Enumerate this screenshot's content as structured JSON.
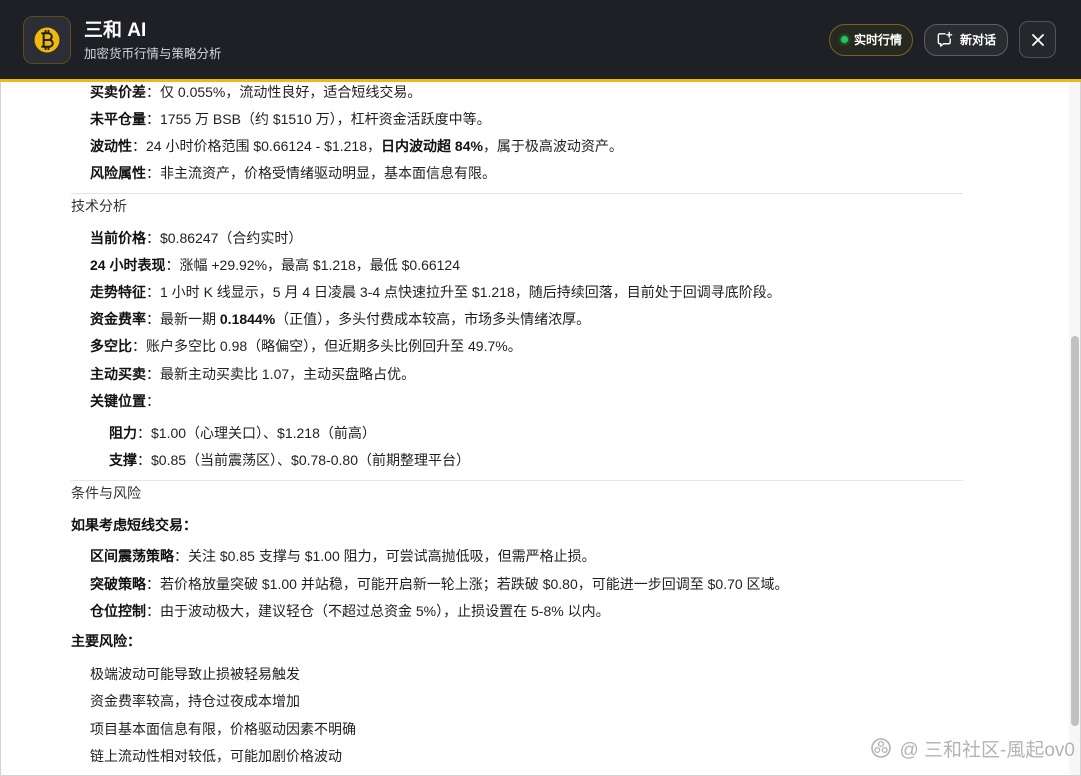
{
  "theme": {
    "accent": "#f0b90b",
    "header_bg": "#1e2026",
    "live_dot": "#22c55e",
    "text": "#1f1f1f"
  },
  "header": {
    "logo_icon": "bitcoin-icon",
    "title": "三和 AI",
    "subtitle": "加密货币行情与策略分析",
    "live_label": "实时行情",
    "new_chat_icon": "chat-plus-icon",
    "new_chat_label": "新对话",
    "close_icon": "close-icon"
  },
  "market": {
    "items": [
      {
        "label": "买卖价差",
        "text": "：仅 0.055%，流动性良好，适合短线交易。"
      },
      {
        "label": "未平仓量",
        "text": "：1755 万 BSB（约 $1510 万），杠杆资金活跃度中等。"
      },
      {
        "label": "波动性",
        "text": "：24 小时价格范围 $0.66124 - $1.218，",
        "bold": "日内波动超 84%",
        "tail": "，属于极高波动资产。"
      },
      {
        "label": "风险属性",
        "text": "：非主流资产，价格受情绪驱动明显，基本面信息有限。"
      }
    ]
  },
  "technical": {
    "heading": "技术分析",
    "items": [
      {
        "label": "当前价格",
        "text": "：$0.86247（合约实时）"
      },
      {
        "label": "24 小时表现",
        "text": "：涨幅 +29.92%，最高 $1.218，最低 $0.66124"
      },
      {
        "label": "走势特征",
        "text": "：1 小时 K 线显示，5 月 4 日凌晨 3-4 点快速拉升至 $1.218，随后持续回落，目前处于回调寻底阶段。"
      },
      {
        "label": "资金费率",
        "text": "：最新一期 ",
        "bold": "0.1844%",
        "tail": "（正值），多头付费成本较高，市场多头情绪浓厚。"
      },
      {
        "label": "多空比",
        "text": "：账户多空比 0.98（略偏空），但近期多头比例回升至 49.7%。"
      },
      {
        "label": "主动买卖",
        "text": "：最新主动买卖比 1.07，主动买盘略占优。"
      },
      {
        "label": "关键位置",
        "text": "："
      }
    ],
    "levels": [
      {
        "label": "阻力",
        "text": "：$1.00（心理关口）、$1.218（前高）"
      },
      {
        "label": "支撑",
        "text": "：$0.85（当前震荡区）、$0.78-0.80（前期整理平台）"
      }
    ]
  },
  "conditions": {
    "heading": "条件与风险",
    "strategy_title": "如果考虑短线交易：",
    "strategies": [
      {
        "label": "区间震荡策略",
        "text": "：关注 $0.85 支撑与 $1.00 阻力，可尝试高抛低吸，但需严格止损。"
      },
      {
        "label": "突破策略",
        "text": "：若价格放量突破 $1.00 并站稳，可能开启新一轮上涨；若跌破 $0.80，可能进一步回调至 $0.70 区域。"
      },
      {
        "label": "仓位控制",
        "text": "：由于波动极大，建议轻仓（不超过总资金 5%），止损设置在 5-8% 以内。"
      }
    ],
    "risk_title": "主要风险：",
    "risks": [
      "极端波动可能导致止损被轻易触发",
      "资金费率较高，持仓过夜成本增加",
      "项目基本面信息有限，价格驱动因素不明确",
      "链上流动性相对较低，可能加剧价格波动"
    ]
  },
  "watermark": {
    "icon": "community-logo-icon",
    "text": "@ 三和社区-風起ov0"
  }
}
